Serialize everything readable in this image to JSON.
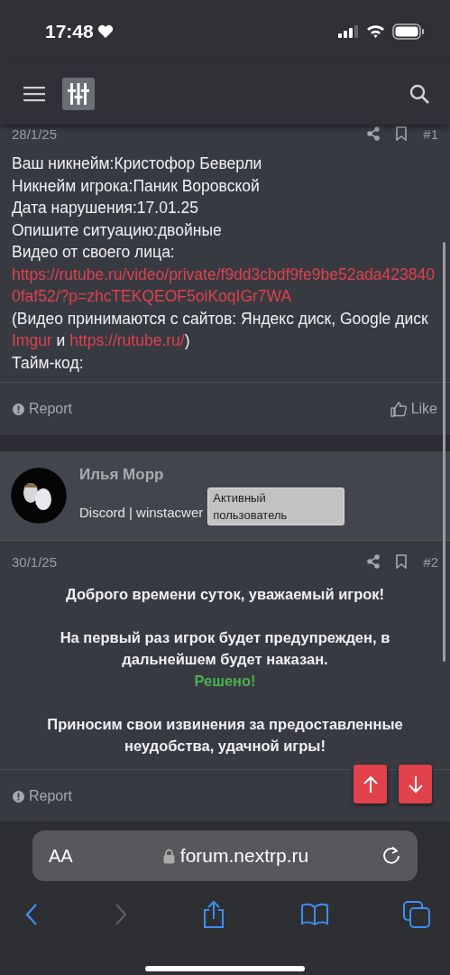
{
  "status_bar": {
    "time": "17:48"
  },
  "posts": [
    {
      "date": "28/1/25",
      "number": "#1",
      "body": [
        {
          "kind": "text",
          "text": "Ваш никнейм:Кристофор Беверли"
        },
        {
          "kind": "text",
          "text": "Никнейм игрока:Паник Воровской"
        },
        {
          "kind": "text",
          "text": "Дата нарушения:17.01.25"
        },
        {
          "kind": "text",
          "text": "Опишите ситуацию:двойные"
        },
        {
          "kind": "text",
          "text": "Видео от своего лица:"
        },
        {
          "kind": "link",
          "text": "https://rutube.ru/video/private/f9dd3cbdf9fe9be52ada4238400faf52/?p=zhcTEKQEOF5oiKoqIGr7WA"
        },
        {
          "kind": "mixed",
          "parts": [
            {
              "kind": "text",
              "text": "(Видео принимаются с сайтов: Яндекс диск, Google диск "
            },
            {
              "kind": "link",
              "text": "Imgur"
            },
            {
              "kind": "text",
              "text": " и "
            },
            {
              "kind": "link",
              "text": "https://rutube.ru/"
            },
            {
              "kind": "text",
              "text": ")"
            }
          ]
        },
        {
          "kind": "text",
          "text": "Тайм-код:"
        }
      ],
      "report": "Report",
      "like": "Like"
    },
    {
      "author": {
        "name": "Илья Морр",
        "signature": "Discord | winstacwer",
        "badge": "Активный пользователь"
      },
      "date": "30/1/25",
      "number": "#2",
      "body": [
        {
          "kind": "bold",
          "text": "Доброго времени суток, уважаемый игрок!"
        },
        {
          "kind": "blank"
        },
        {
          "kind": "bold",
          "text": "На первый раз игрок будет предупрежден, в дальнейшем будет наказан."
        },
        {
          "kind": "success",
          "text": "Решено!"
        },
        {
          "kind": "blank"
        },
        {
          "kind": "bold",
          "text": "Приносим свои извинения за предоставленные неудобства, удачной игры!"
        }
      ],
      "report": "Report"
    }
  ],
  "address_bar": {
    "text_size": "AA",
    "url": "forum.nextrp.ru"
  }
}
